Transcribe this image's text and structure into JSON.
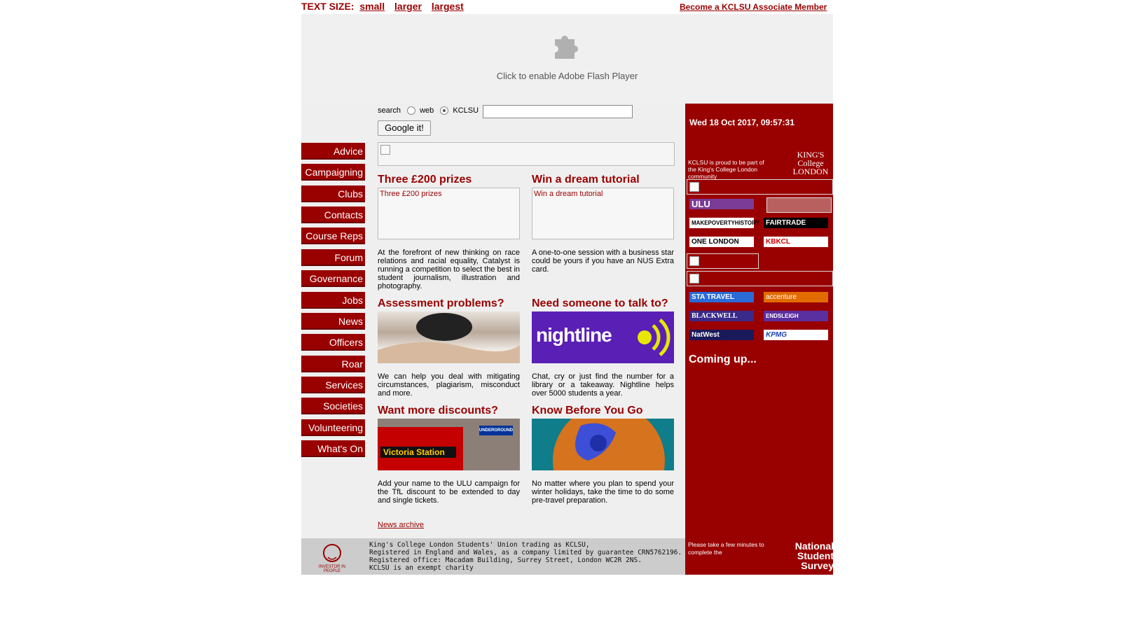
{
  "header": {
    "text_size_label": "TEXT SIZE:",
    "sizes": [
      "small",
      "larger",
      "largest"
    ],
    "associate_link": "Become a KCLSU Associate Member"
  },
  "flash": {
    "message": "Click to enable Adobe Flash Player",
    "icon": "puzzle-icon"
  },
  "nav": [
    "Advice",
    "Campaigning",
    "Clubs",
    "Contacts",
    "Course Reps",
    "Forum",
    "Governance",
    "Jobs",
    "News",
    "Officers",
    "Roar",
    "Services",
    "Societies",
    "Volunteering",
    "What's On"
  ],
  "search": {
    "label": "search",
    "option_web": "web",
    "option_kclsu": "KCLSU",
    "selected": "KCLSU",
    "value": "",
    "button": "Google it!"
  },
  "articles": [
    {
      "title": "Three £200 prizes",
      "img_alt": "Three £200 prizes",
      "text": "At the forefront of new thinking on race relations and racial equality, Catalyst is running a competition to select the best in student journalism, illustration and photography."
    },
    {
      "title": "Win a dream tutorial",
      "img_alt": "Win a dream tutorial",
      "text": "A one-to-one session with a business star could be yours if you have an NUS Extra card."
    },
    {
      "title": "Assessment problems?",
      "text": "We can help you deal with mitigating circumstances, plagiarism, misconduct and more."
    },
    {
      "title": "Need someone to talk to?",
      "img_text": "nightline",
      "text": "Chat, cry or just find the number for a library or a takeaway. Nightline helps over 5000 students a year."
    },
    {
      "title": "Want more discounts?",
      "img_text": "Victoria Station",
      "img_sign": "UNDERGROUND",
      "text": "Add your name to the ULU campaign for the TfL discount to be extended to day and single tickets."
    },
    {
      "title": "Know Before You Go",
      "text": "No matter where you plan to spend your winter holidays, take the time to do some pre-travel preparation."
    }
  ],
  "news_archive": "News archive",
  "sidebar": {
    "datetime": "Wed 18 Oct 2017, 09:57:31",
    "kings_text": "KCLSU is proud to be part of the King's College London community",
    "kings_logo": "KING'S College LONDON",
    "partners": [
      "ULU",
      "MAKEPOVERTYHISTORY",
      "FAIRTRADE",
      "ONE LONDON",
      "KBKCL"
    ],
    "sponsors": [
      "STA TRAVEL",
      "accenture",
      "BLACKWELL",
      "ENDSLEIGH",
      "NatWest",
      "KPMG"
    ],
    "coming_up": "Coming up..."
  },
  "footer": {
    "investor": "INVESTOR IN PEOPLE",
    "legal": [
      "King's College London Students' Union trading as KCLSU,",
      "Registered in England and Wales, as a company limited by guarantee CRN5762196.",
      "Registered office: Macadam Building, Surrey Street, London WC2R 2NS.",
      "KCLSU is an exempt charity"
    ],
    "nss_text": "Please take a few minutes to complete the",
    "nss_logo": "National Student Survey"
  },
  "colors": {
    "brand": "#990000",
    "panel": "#efefef",
    "footer": "#cccccc"
  }
}
